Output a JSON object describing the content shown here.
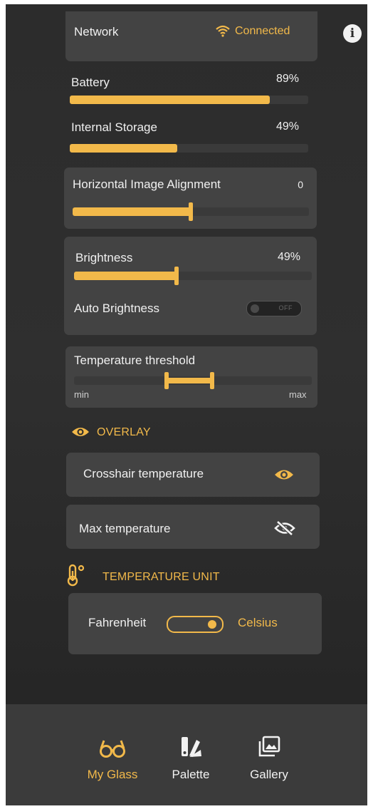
{
  "network": {
    "label": "Network",
    "status": "Connected"
  },
  "battery": {
    "label": "Battery",
    "value_text": "89%",
    "level": 0.84
  },
  "storage": {
    "label": "Internal Storage",
    "value_text": "49%",
    "level": 0.45
  },
  "alignment": {
    "label": "Horizontal Image Alignment",
    "value_text": "0",
    "level": 0.5
  },
  "brightness": {
    "label": "Brightness",
    "value_text": "49%",
    "level": 0.43,
    "auto_label": "Auto Brightness",
    "auto_state": "OFF"
  },
  "temperature_threshold": {
    "label": "Temperature threshold",
    "min_label": "min",
    "max_label": "max",
    "range": [
      0.39,
      0.58
    ]
  },
  "overlay": {
    "heading": "OVERLAY",
    "items": [
      {
        "label": "Crosshair temperature",
        "visible": true
      },
      {
        "label": "Max temperature",
        "visible": false
      }
    ]
  },
  "temperature_unit": {
    "heading": "TEMPERATURE UNIT",
    "left_label": "Fahrenheit",
    "right_label": "Celsius",
    "selected": "Celsius"
  },
  "bottom_nav": {
    "items": [
      {
        "label": "My Glass",
        "icon": "glasses-icon",
        "active": true
      },
      {
        "label": "Palette",
        "icon": "palette-icon",
        "active": false
      },
      {
        "label": "Gallery",
        "icon": "gallery-icon",
        "active": false
      }
    ]
  },
  "colors": {
    "accent": "#f2b94a",
    "card": "#434343",
    "background": "#2c2c2c",
    "nav": "#3b3b3b"
  }
}
